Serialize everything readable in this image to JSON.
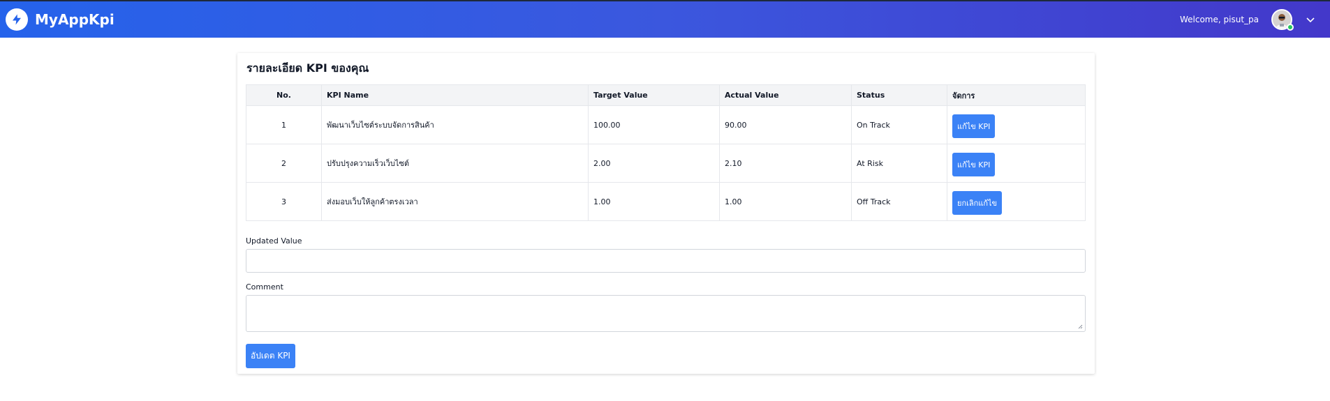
{
  "header": {
    "brand": "MyAppKpi",
    "welcome": "Welcome, pisut_pa",
    "brand_color": "#2563eb"
  },
  "card": {
    "title": "รายละเอียด KPI ของคุณ"
  },
  "table": {
    "headers": [
      "No.",
      "KPI Name",
      "Target Value",
      "Actual Value",
      "Status",
      "จัดการ"
    ],
    "rows": [
      {
        "no": "1",
        "name": "พัฒนาเว็บไซต์ระบบจัดการสินค้า",
        "target": "100.00",
        "actual": "90.00",
        "status": "On Track",
        "action": "แก้ไข KPI"
      },
      {
        "no": "2",
        "name": "ปรับปรุงความเร็วเว็บไซต์",
        "target": "2.00",
        "actual": "2.10",
        "status": "At Risk",
        "action": "แก้ไข KPI"
      },
      {
        "no": "3",
        "name": "ส่งมอบเว็บให้ลูกค้าตรงเวลา",
        "target": "1.00",
        "actual": "1.00",
        "status": "Off Track",
        "action": "ยกเลิกแก้ไข"
      }
    ]
  },
  "form": {
    "updated_value_label": "Updated Value",
    "updated_value": "",
    "comment_label": "Comment",
    "comment": "",
    "submit_label": "อัปเดต KPI"
  },
  "colors": {
    "button": "#3b82f6",
    "online": "#22c55e"
  }
}
